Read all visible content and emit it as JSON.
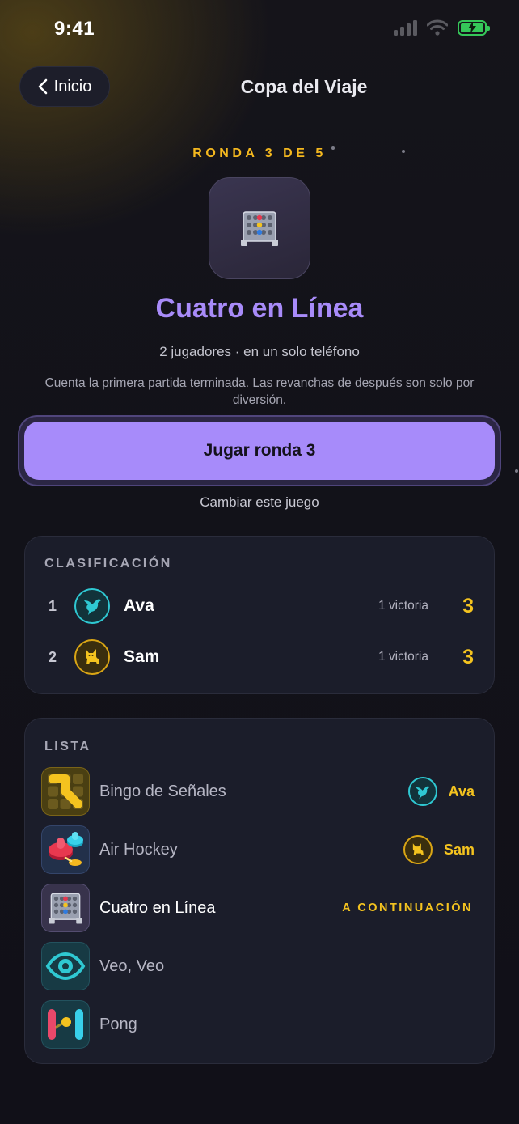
{
  "status_bar": {
    "time": "9:41"
  },
  "header": {
    "back_label": "Inicio",
    "title": "Copa del Viaje"
  },
  "round": {
    "label": "RONDA 3 DE 5",
    "current": 3,
    "total": 5
  },
  "game": {
    "title": "Cuatro en Línea",
    "subtitle": "2 jugadores · en un solo teléfono",
    "description": "Cuenta la primera partida terminada. Las revanchas de después son solo por diversión.",
    "play_label": "Jugar ronda 3",
    "change_label": "Cambiar este juego",
    "icon": "connect-four-icon"
  },
  "standings": {
    "label": "CLASIFICACIÓN",
    "rows": [
      {
        "rank": "1",
        "name": "Ava",
        "wins": "1 victoria",
        "score": "3",
        "avatar": "hummingbird-icon",
        "color": "#2fc8d2"
      },
      {
        "rank": "2",
        "name": "Sam",
        "wins": "1 victoria",
        "score": "3",
        "avatar": "cat-icon",
        "color": "#d9a515"
      }
    ]
  },
  "list": {
    "label": "LISTA",
    "items": [
      {
        "name": "Bingo de Señales",
        "winner": "Ava",
        "winner_avatar": "hummingbird-icon",
        "icon": "signal-bingo-icon"
      },
      {
        "name": "Air Hockey",
        "winner": "Sam",
        "winner_avatar": "cat-icon",
        "icon": "air-hockey-icon"
      },
      {
        "name": "Cuatro en Línea",
        "status": "A CONTINUACIÓN",
        "icon": "connect-four-icon"
      },
      {
        "name": "Veo, Veo",
        "icon": "eye-icon"
      },
      {
        "name": "Pong",
        "icon": "pong-icon"
      }
    ]
  },
  "colors": {
    "accent": "#a78bfa",
    "gold": "#f4c31f",
    "teal": "#2fc8d2"
  }
}
